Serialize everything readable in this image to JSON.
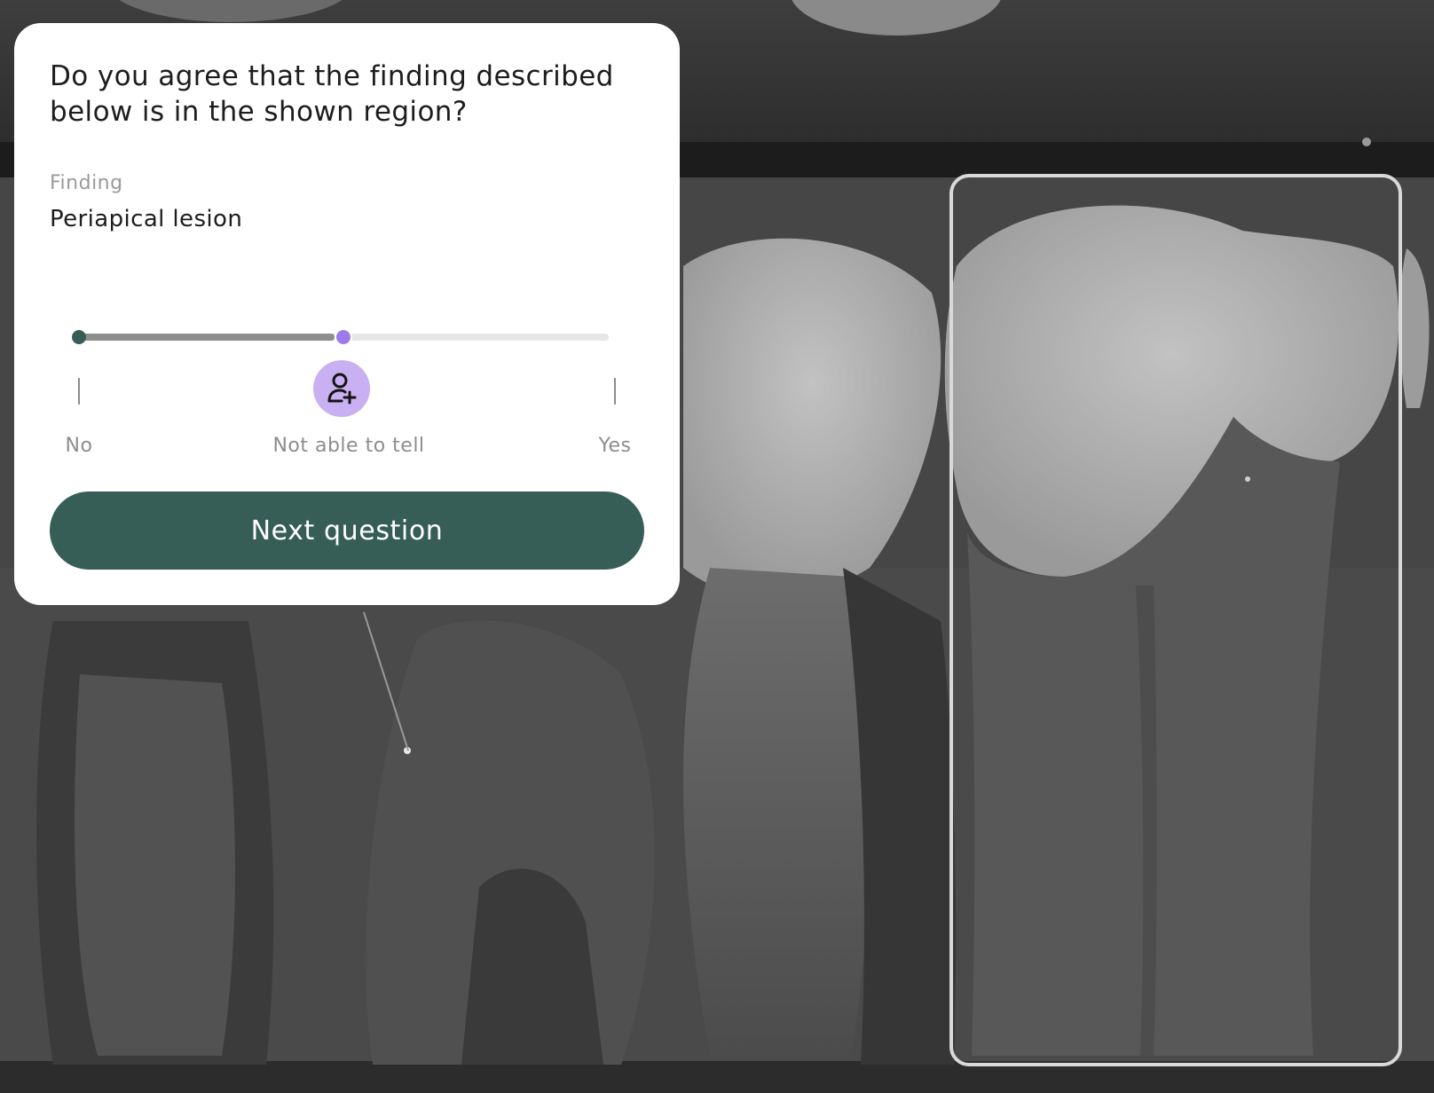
{
  "prompt": {
    "question": "Do you agree that the finding described below is in the shown region?"
  },
  "finding": {
    "label": "Finding",
    "value": "Periapical lesion"
  },
  "slider": {
    "options": [
      "No",
      "Not able to tell",
      "Yes"
    ],
    "selected": "Not able to tell",
    "position_fraction": 0.5,
    "handle_icon": "add-user-icon",
    "colors": {
      "handle_dot": "#9d7bea",
      "handle_badge": "#c9b0f2",
      "track_fill": "#8e8e8e",
      "start_dot": "#365e56"
    }
  },
  "actions": {
    "next_label": "Next question"
  },
  "theme": {
    "primary": "#365e56",
    "region_outline": "#d9d9d9"
  }
}
